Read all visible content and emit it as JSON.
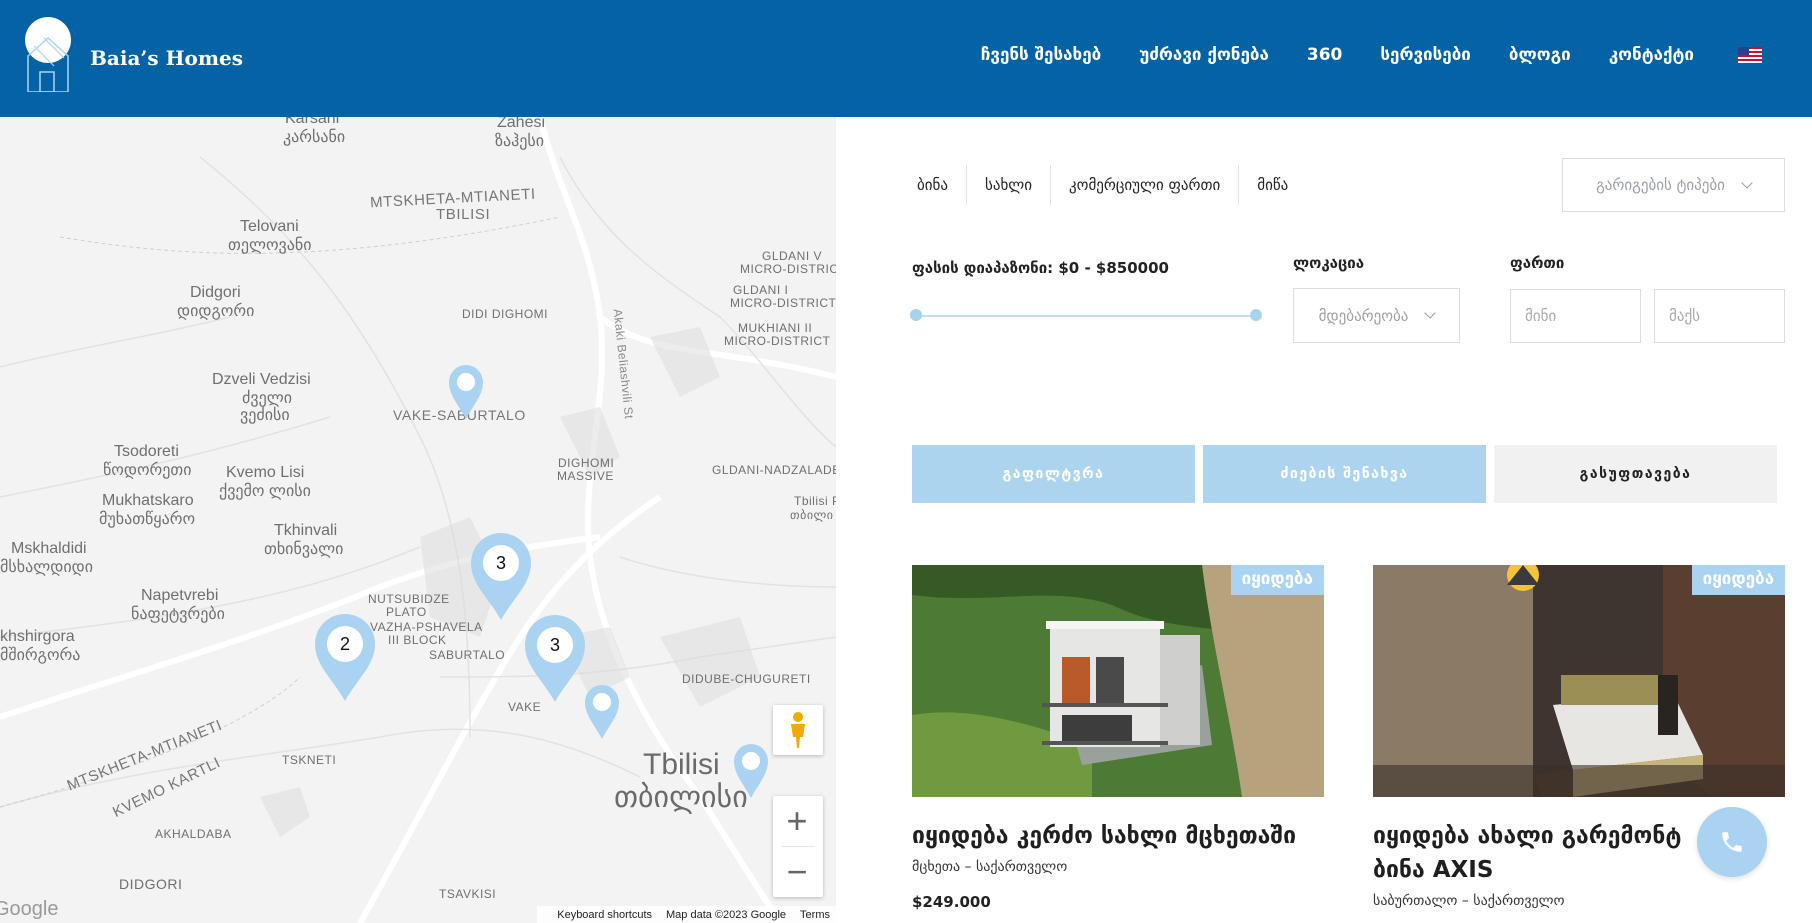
{
  "header": {
    "logo_text": "Baia’s Homes",
    "nav": [
      "ჩვენს შესახებ",
      "უძრავი ქონება",
      "360",
      "სერვისები",
      "ბლოგი",
      "კონტაქტი"
    ],
    "flag_icon": "us-flag-icon"
  },
  "map": {
    "labels": {
      "karsani": "Karsani",
      "karsani_ka": "კარსანი",
      "zahesi": "Zahesi",
      "zahesi_ka": "ზაჰესი",
      "mtskheta": "MTSKHETA-MTIANETI",
      "tbilisi_region": "TBILISI",
      "telovani": "Telovani",
      "telovani_ka": "თელოვანი",
      "didgori": "Didgori",
      "didgori_ka": "დიდგორი",
      "didi_dighomi": "DIDI DIGHOMI",
      "gldani_v": "GLDANI V",
      "gldani_v2": "MICRO-DISTRICT",
      "gldani_i": "GLDANI I",
      "gldani_i2": "MICRO-DISTRICT",
      "mukhiani": "MUKHIANI II",
      "mukhiani2": "MICRO-DISTRICT",
      "street": "Akaki Beliashvili St",
      "dzveli": "Dzveli Vedzisi",
      "dzveli_ka1": "ძველი",
      "dzveli_ka2": "ვეძისი",
      "vake_saburtalo": "VAKE-SABURTALO",
      "tsodoreti": "Tsodoreti",
      "tsodoreti_ka": "წოდორეთი",
      "kvemo_lisi": "Kvemo Lisi",
      "kvemo_lisi_ka": "ქვემო ლისი",
      "mukhatskaro": "Mukhatskaro",
      "mukhatskaro_ka": "მუხათწყარო",
      "dighomi": "DIGHOMI",
      "dighomi2": "MASSIVE",
      "gldani_nadzaladevi": "GLDANI-NADZALADE",
      "tbilisi_p": "Tbilisi P",
      "tbilisi_p_ka": "თბილი",
      "tkhinvali": "Tkhinvali",
      "tkhinvali_ka": "თხინვალი",
      "mskhaldidi": "Mskhaldidi",
      "mskhaldidi_ka": "მსხალდიდი",
      "napetvrebi": "Napetvrebi",
      "napetvrebi_ka": "ნაფეტვრები",
      "nutsubidze": "NUTSUBIDZE",
      "nutsubidze2": "PLATO",
      "vazha": "VAZHA-PSHAVELA",
      "vazha2": "III BLOCK",
      "saburtalo": "SABURTALO",
      "shirgora": "khshirgora",
      "shirgora_ka": "მშირგორა",
      "didube": "DIDUBE-CHUGURETI",
      "vake": "VAKE",
      "mtskheta2": "MTSKHETA-MTIANETI",
      "kvemo_kartli": "KVEMO KARTLI",
      "tskneti": "TSKNETI",
      "tbilisi_city": "Tbilisi",
      "tbilisi_city_ka": "თბილისი",
      "akhaldaba": "AKHALDABA",
      "didgori2": "DIDGORI",
      "tsavkisi": "TSAVKISI"
    },
    "clusters": [
      "3",
      "2",
      "3"
    ],
    "attribution": {
      "shortcuts": "Keyboard shortcuts",
      "data": "Map data ©2023 Google",
      "terms": "Terms"
    },
    "google": "Google",
    "zoom_in": "+",
    "zoom_out": "−"
  },
  "filters": {
    "tabs": [
      "ბინა",
      "სახლი",
      "კომერციული ფართი",
      "მიწა"
    ],
    "sort_placeholder": "გარიგების ტიპები",
    "price_label": "ფასის დიაპაზონი: $0 - $850000",
    "price_range": {
      "min": 0,
      "max": 850000,
      "selected_min": 0,
      "selected_max": 850000
    },
    "location_label": "ლოკაცია",
    "location_placeholder": "მდებარეობა",
    "area_label": "ფართი",
    "area_min_placeholder": "მინი",
    "area_max_placeholder": "მაქს",
    "buttons": {
      "filter": "გაფილტვრა",
      "save": "ძიების შენახვა",
      "clear": "გასუფთავება"
    }
  },
  "listings": [
    {
      "badge": "იყიდება",
      "title": "იყიდება კერძო სახლი მცხეთაში",
      "location": "მცხეთა – საქართველო",
      "price": "$249.000"
    },
    {
      "badge": "იყიდება",
      "title": "იყიდება ახალი გარემონტ... ბინა AXIS",
      "title_line1": "იყიდება ახალი გარემონტ",
      "title_line2": "ბინა AXIS",
      "location": "საბურთალო – საქართველო"
    }
  ],
  "colors": {
    "brand": "#0563a5",
    "accent": "#acd4ee",
    "pin": "#a9d3f1"
  }
}
